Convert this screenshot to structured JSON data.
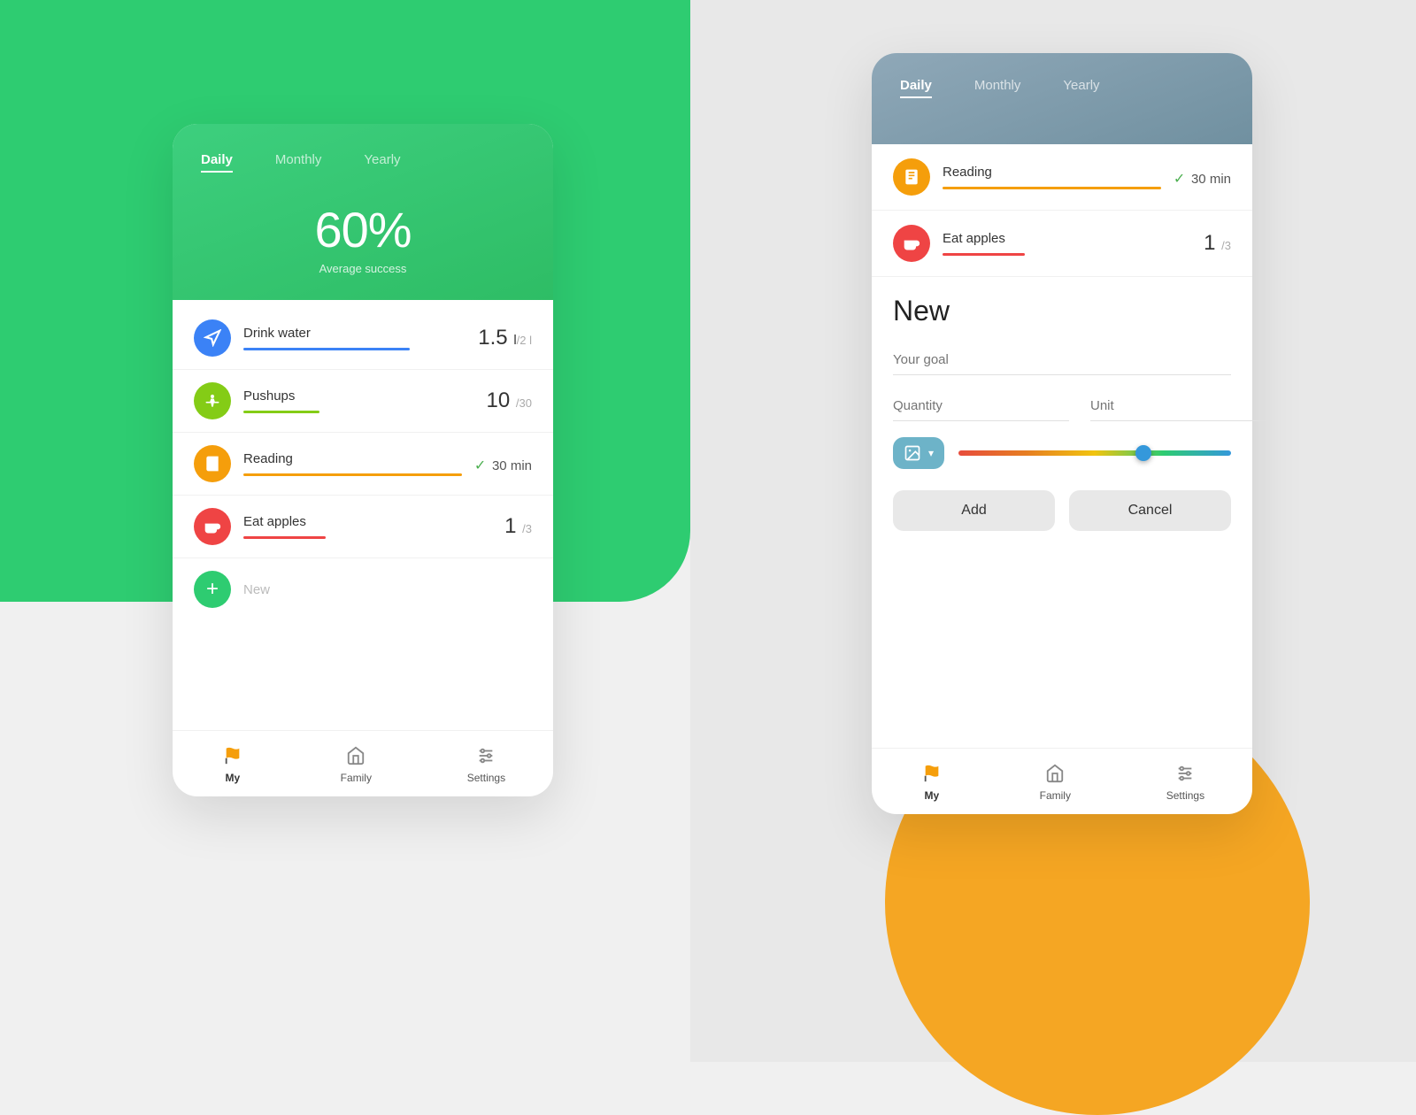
{
  "background": {
    "green_color": "#2ecc71",
    "orange_color": "#f5a623",
    "gray_color": "#e8e8e8"
  },
  "left_card": {
    "tabs": [
      "Daily",
      "Monthly",
      "Yearly"
    ],
    "active_tab": "Daily",
    "percent": "60%",
    "avg_label": "Average success",
    "habits": [
      {
        "name": "Drink water",
        "icon_color": "#3b82f6",
        "icon": "utensils",
        "value": "1.5",
        "value_unit": "l",
        "target": "/2 l",
        "progress_color": "#3b82f6",
        "progress_width": "75%"
      },
      {
        "name": "Pushups",
        "icon_color": "#84cc16",
        "icon": "dumbbell",
        "value": "10",
        "value_unit": "",
        "target": "/30",
        "progress_color": "#84cc16",
        "progress_width": "33%"
      },
      {
        "name": "Reading",
        "icon_color": "#f59e0b",
        "icon": "book",
        "value": "30 min",
        "check": true,
        "progress_color": "#f59e0b",
        "progress_width": "100%"
      },
      {
        "name": "Eat apples",
        "icon_color": "#ef4444",
        "icon": "utensils",
        "value": "1",
        "value_unit": "",
        "target": "/3",
        "progress_color": "#ef4444",
        "progress_width": "33%"
      }
    ],
    "new_item_label": "New",
    "nav": [
      {
        "label": "My",
        "active": true
      },
      {
        "label": "Family",
        "active": false
      },
      {
        "label": "Settings",
        "active": false
      }
    ]
  },
  "right_card": {
    "tabs": [
      "Daily",
      "Monthly",
      "Yearly"
    ],
    "active_tab": "Daily",
    "habits": [
      {
        "name": "Reading",
        "icon_color": "#f59e0b",
        "icon": "book",
        "value": "30 min",
        "check": true,
        "progress_color": "#f59e0b",
        "progress_width": "100%"
      },
      {
        "name": "Eat apples",
        "icon_color": "#ef4444",
        "icon": "utensils",
        "value": "1",
        "value_unit": "",
        "target": "/3",
        "progress_color": "#ef4444",
        "progress_width": "33%"
      }
    ],
    "form": {
      "title": "New",
      "goal_placeholder": "Your goal",
      "quantity_placeholder": "Quantity",
      "unit_placeholder": "Unit",
      "add_button": "Add",
      "cancel_button": "Cancel"
    },
    "nav": [
      {
        "label": "My",
        "active": true
      },
      {
        "label": "Family",
        "active": false
      },
      {
        "label": "Settings",
        "active": false
      }
    ]
  }
}
